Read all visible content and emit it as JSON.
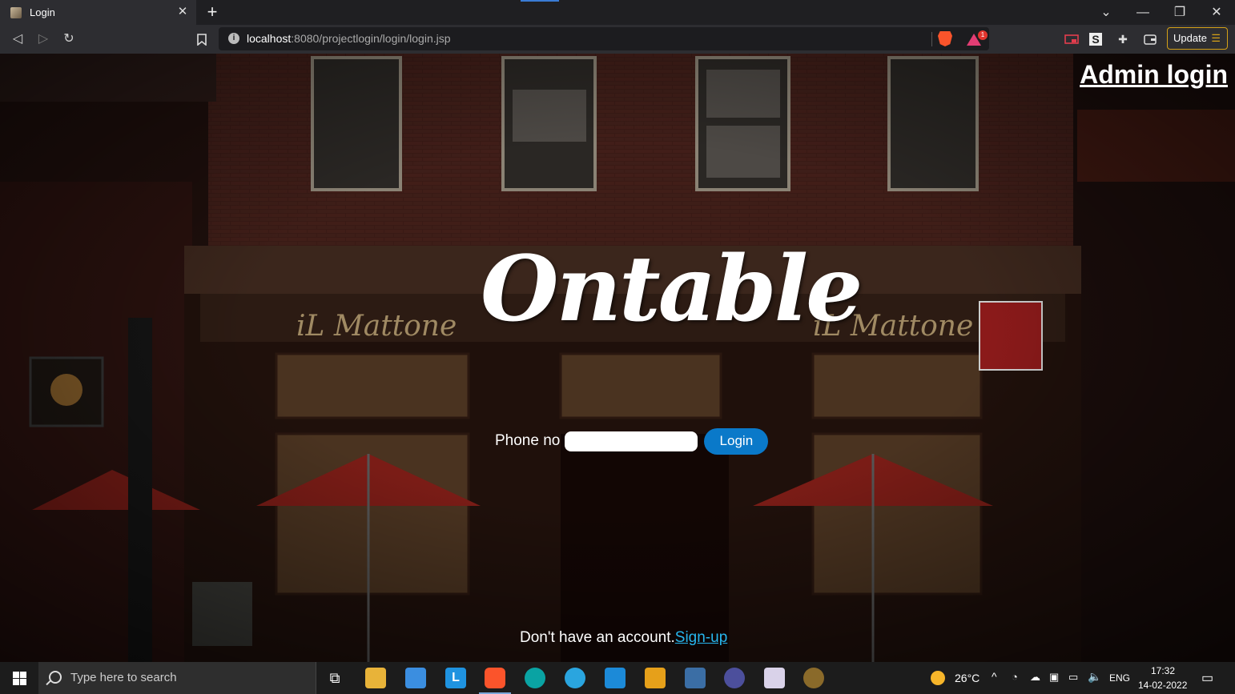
{
  "browser": {
    "tab_title": "Login",
    "url_host": "localhost",
    "url_rest": ":8080/projectlogin/login/login.jsp",
    "update_label": "Update",
    "brave_badge_count": "1"
  },
  "page": {
    "admin_link": "Admin login",
    "logo_text": "Ontable",
    "phone_label": "Phone no",
    "phone_value": "",
    "login_button": "Login",
    "signup_prompt": "Don't have an account.",
    "signup_link": "Sign-up"
  },
  "taskbar": {
    "search_placeholder": "Type here to search",
    "temperature": "26°C",
    "language": "ENG",
    "time": "17:32",
    "date": "14-02-2022"
  },
  "colors": {
    "login_button": "#0a79c9",
    "signup_link": "#27b6ee",
    "update_border": "#d4a017"
  }
}
